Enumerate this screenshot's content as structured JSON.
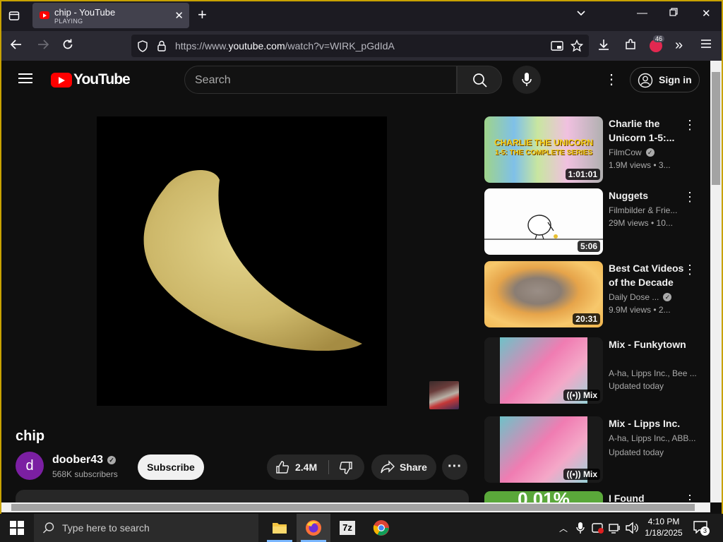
{
  "browser": {
    "tab_title": "chip - YouTube",
    "tab_status": "PLAYING",
    "url_prefix": "https://www.",
    "url_domain": "youtube.com",
    "url_path": "/watch?v=WIRK_pGdIdA",
    "extension_badge": "46"
  },
  "youtube": {
    "logo_text": "YouTube",
    "search_placeholder": "Search",
    "sign_in": "Sign in"
  },
  "video": {
    "title": "chip",
    "channel": {
      "avatar_letter": "d",
      "name": "doober43",
      "subscribers": "568K subscribers"
    },
    "subscribe_label": "Subscribe",
    "likes": "2.4M",
    "share_label": "Share"
  },
  "recommendations": [
    {
      "title": "Charlie the Unicorn 1-5:...",
      "channel": "FilmCow",
      "meta": "1.9M views  • 3...",
      "duration": "1:01:01",
      "thumb_text1": "CHARLIE THE UNICORN",
      "thumb_text2": "1-5: THE COMPLETE SERIES"
    },
    {
      "title": "Nuggets",
      "channel": "Filmbilder & Frie...",
      "meta": "29M views  • 10...",
      "duration": "5:06"
    },
    {
      "title": "Best Cat Videos of the Decade",
      "channel": "Daily Dose ...",
      "meta": "9.9M views  • 2...",
      "duration": "20:31"
    },
    {
      "title": "Mix - Funkytown",
      "channel": "A-ha, Lipps Inc., Bee ...",
      "meta": "Updated today",
      "duration": "Mix"
    },
    {
      "title": "Mix - Lipps Inc.",
      "channel": "A-ha, Lipps Inc., ABB...",
      "meta": "Updated today",
      "duration": "Mix"
    },
    {
      "title": "I Found",
      "thumb_text": "0.01%"
    }
  ],
  "taskbar": {
    "search_placeholder": "Type here to search",
    "time": "4:10 PM",
    "date": "1/18/2025",
    "notification_count": "3",
    "app_7z_label": "7z"
  },
  "colors": {
    "youtube_red": "#ff0000",
    "window_border": "#c8a200",
    "avatar_purple": "#7b1fa2"
  }
}
